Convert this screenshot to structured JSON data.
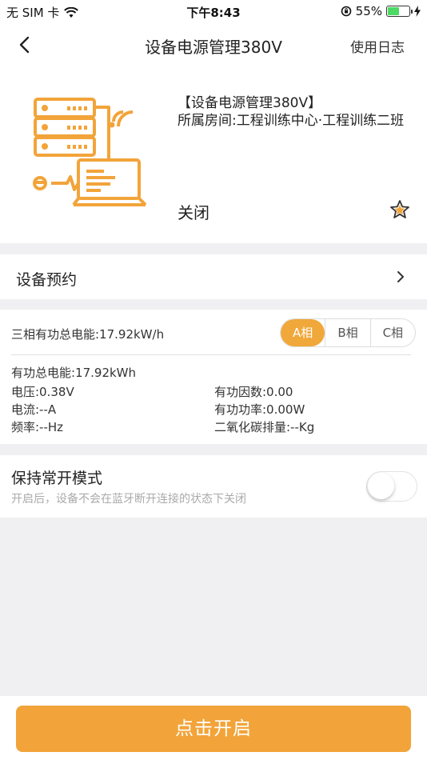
{
  "status_bar": {
    "carrier": "无 SIM 卡",
    "time": "下午8:43",
    "battery_percent": "55%",
    "battery_level": 0.55
  },
  "nav": {
    "title": "设备电源管理380V",
    "log_label": "使用日志"
  },
  "device": {
    "name": "【设备电源管理380V】",
    "room": "所属房间:工程训练中心·工程训练二班",
    "state": "关闭"
  },
  "reserve": {
    "label": "设备预约"
  },
  "power": {
    "total_energy": "三相有功总电能:17.92kW/h",
    "phases": [
      "A相",
      "B相",
      "C相"
    ],
    "active_phase": "A相",
    "active_energy": "有功总电能:17.92kWh",
    "voltage": "电压:0.38V",
    "power_factor": "有功因数:0.00",
    "current": "电流:--A",
    "active_power": "有功功率:0.00W",
    "frequency": "频率:--Hz",
    "co2": "二氧化碳排量:--Kg"
  },
  "keep_open": {
    "title": "保持常开模式",
    "description": "开启后，设备不会在蓝牙断开连接的状态下关闭",
    "enabled": false
  },
  "action": {
    "open_label": "点击开启"
  },
  "colors": {
    "accent": "#f2a43a",
    "background": "#f0f0f2",
    "battery_green": "#4cd964"
  }
}
